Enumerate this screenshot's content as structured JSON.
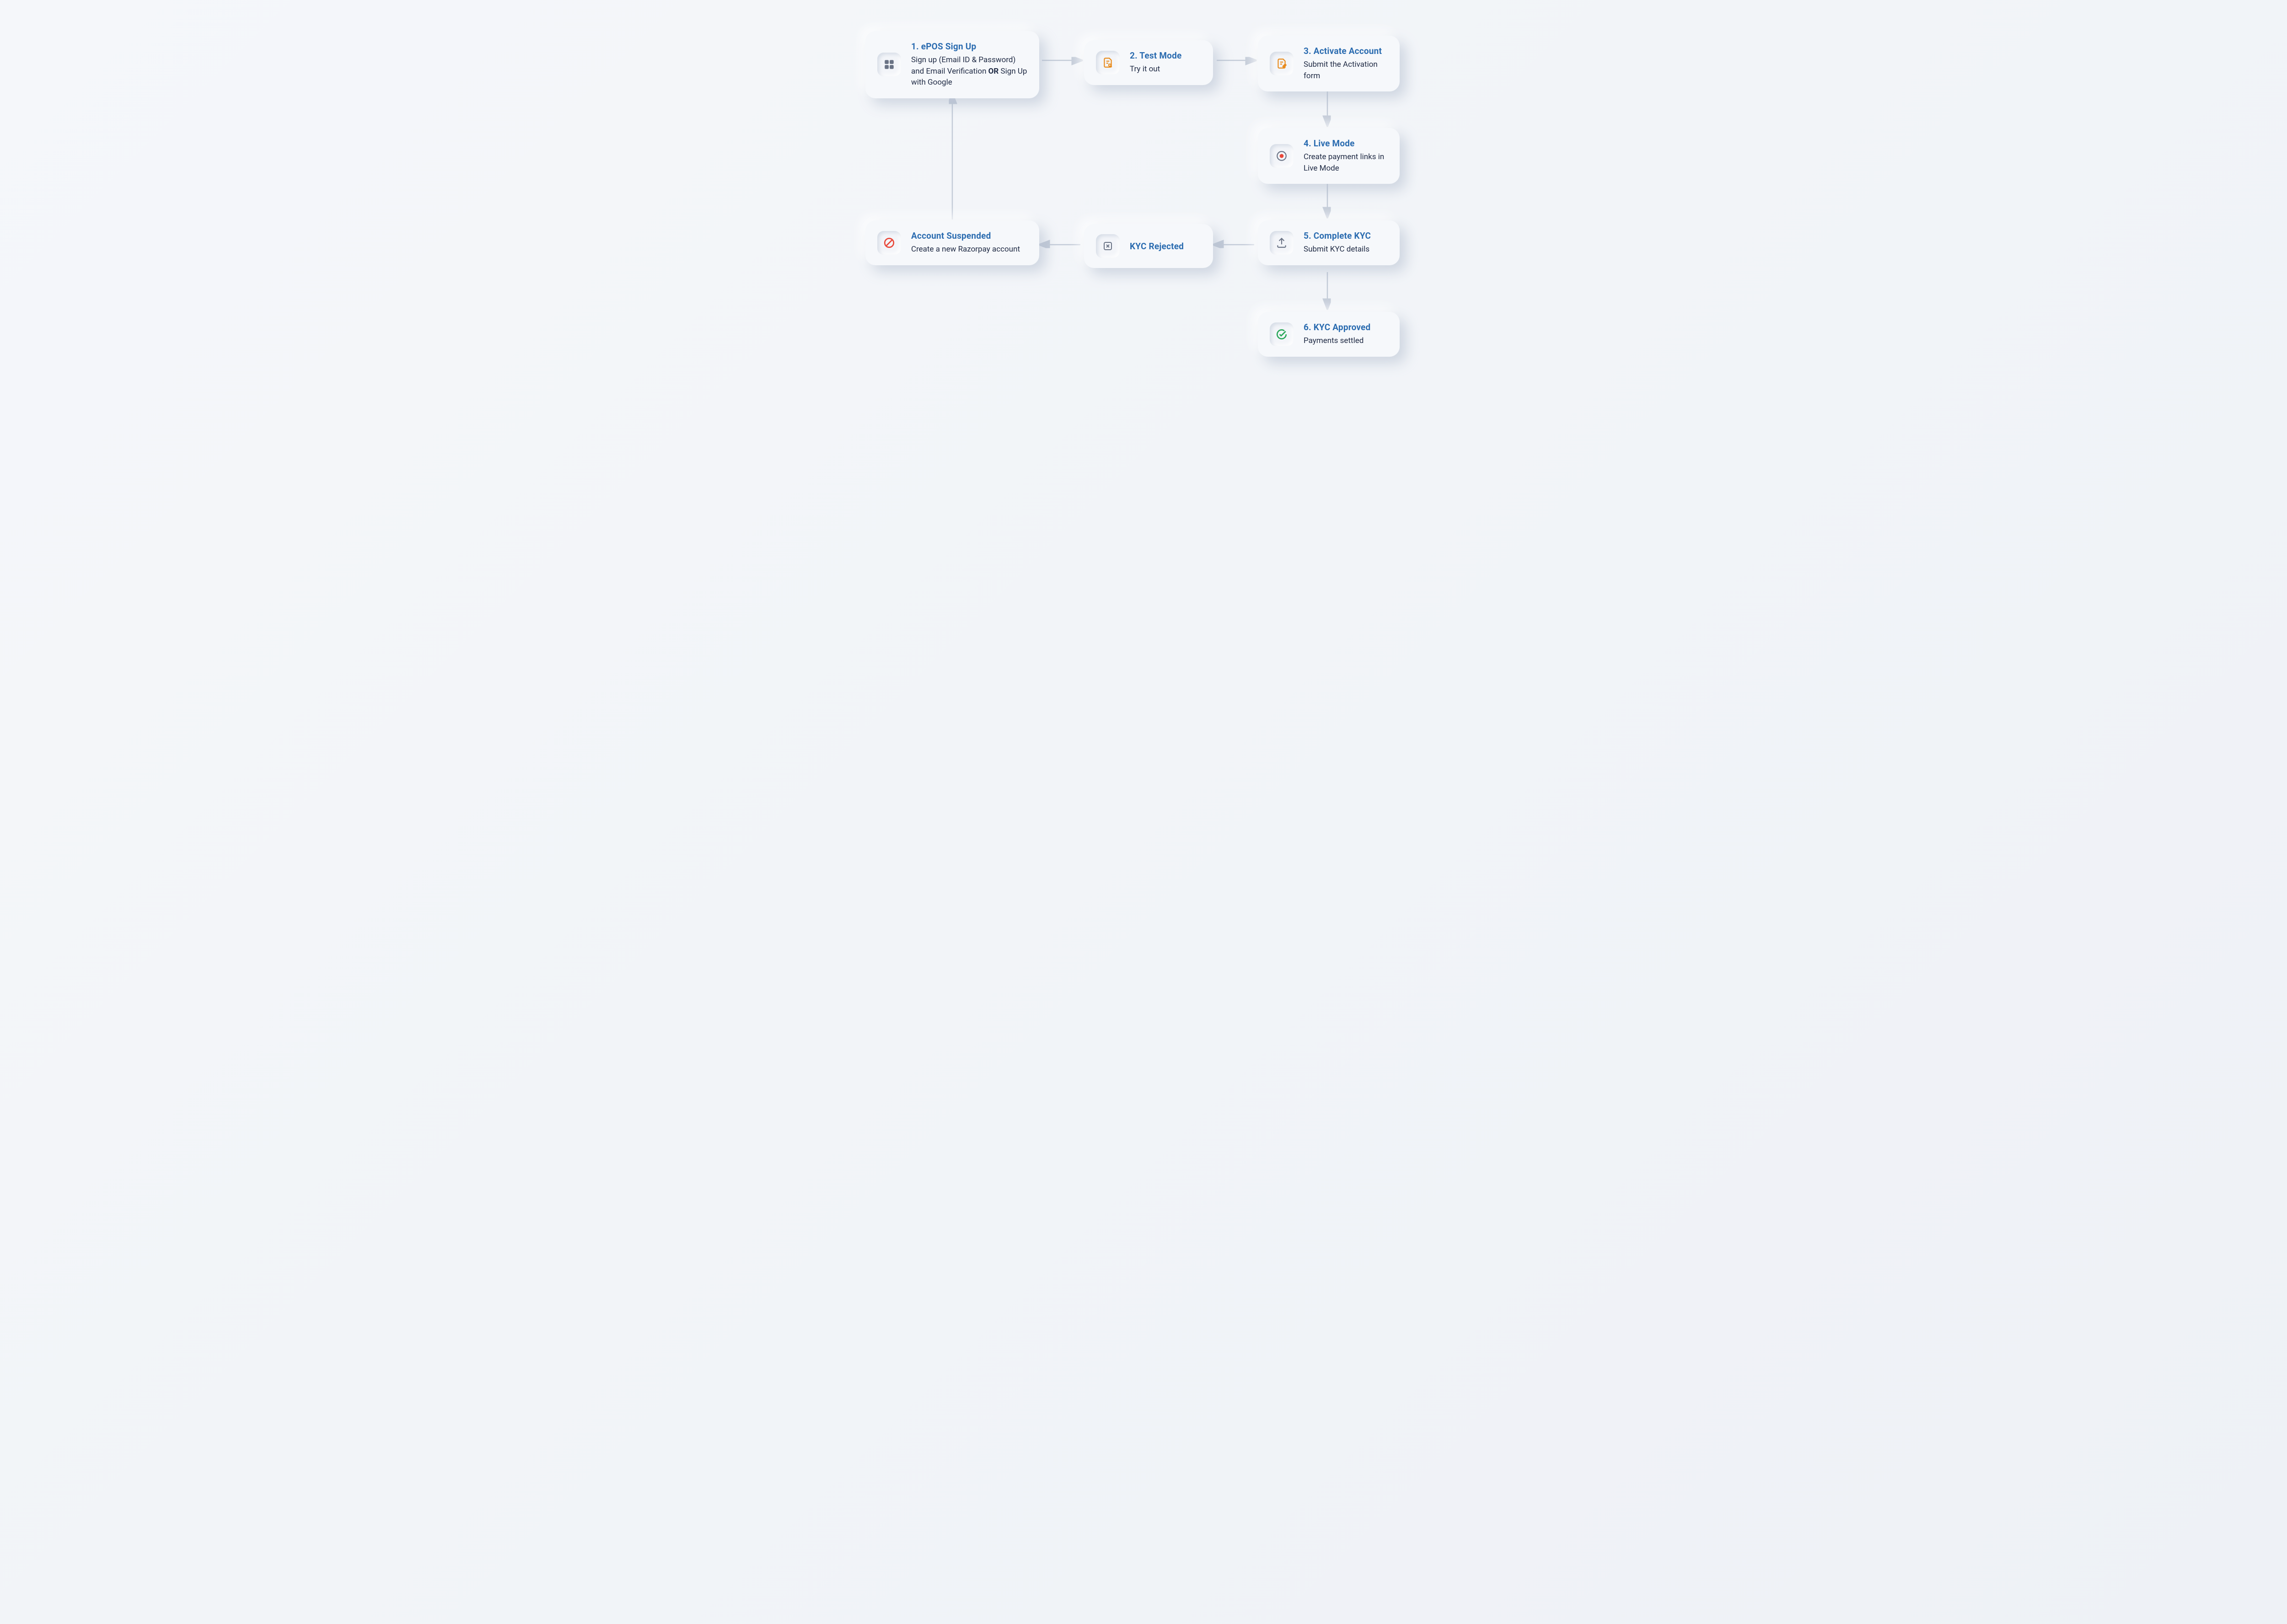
{
  "nodes": {
    "signup": {
      "title": "1. ePOS Sign Up",
      "desc_html": "Sign up (Email ID & Password) and Email Verification <b>OR</b>  Sign Up with Google"
    },
    "testmode": {
      "title": "2. Test Mode",
      "desc": "Try it out"
    },
    "activate": {
      "title": "3. Activate Account",
      "desc": "Submit the Activation form"
    },
    "livemode": {
      "title": "4. Live Mode",
      "desc": "Create payment links in Live Mode"
    },
    "kyc": {
      "title": "5. Complete KYC",
      "desc": "Submit KYC details"
    },
    "approved": {
      "title": "6. KYC Approved",
      "desc": "Payments settled"
    },
    "rejected": {
      "title": "KYC Rejected"
    },
    "suspended": {
      "title": "Account Suspended",
      "desc": "Create a new Razorpay account"
    }
  },
  "flows": [
    {
      "from": "signup",
      "to": "testmode"
    },
    {
      "from": "testmode",
      "to": "activate"
    },
    {
      "from": "activate",
      "to": "livemode"
    },
    {
      "from": "livemode",
      "to": "kyc"
    },
    {
      "from": "kyc",
      "to": "approved"
    },
    {
      "from": "kyc",
      "to": "rejected"
    },
    {
      "from": "rejected",
      "to": "suspended"
    },
    {
      "from": "suspended",
      "to": "signup"
    }
  ],
  "icons": {
    "signup": "grid-icon",
    "testmode": "document-search-icon",
    "activate": "document-edit-icon",
    "livemode": "record-dot-icon",
    "kyc": "upload-icon",
    "approved": "checkmark-circle-icon",
    "rejected": "x-square-icon",
    "suspended": "prohibit-icon"
  },
  "colors": {
    "title": "#2b6cb0",
    "arrow": "#c3cbd8",
    "text": "#1f2a44",
    "icon_orange": "#e88b1c",
    "icon_red": "#e8483a",
    "icon_green": "#2aa85a",
    "icon_grey": "#6a7385"
  }
}
